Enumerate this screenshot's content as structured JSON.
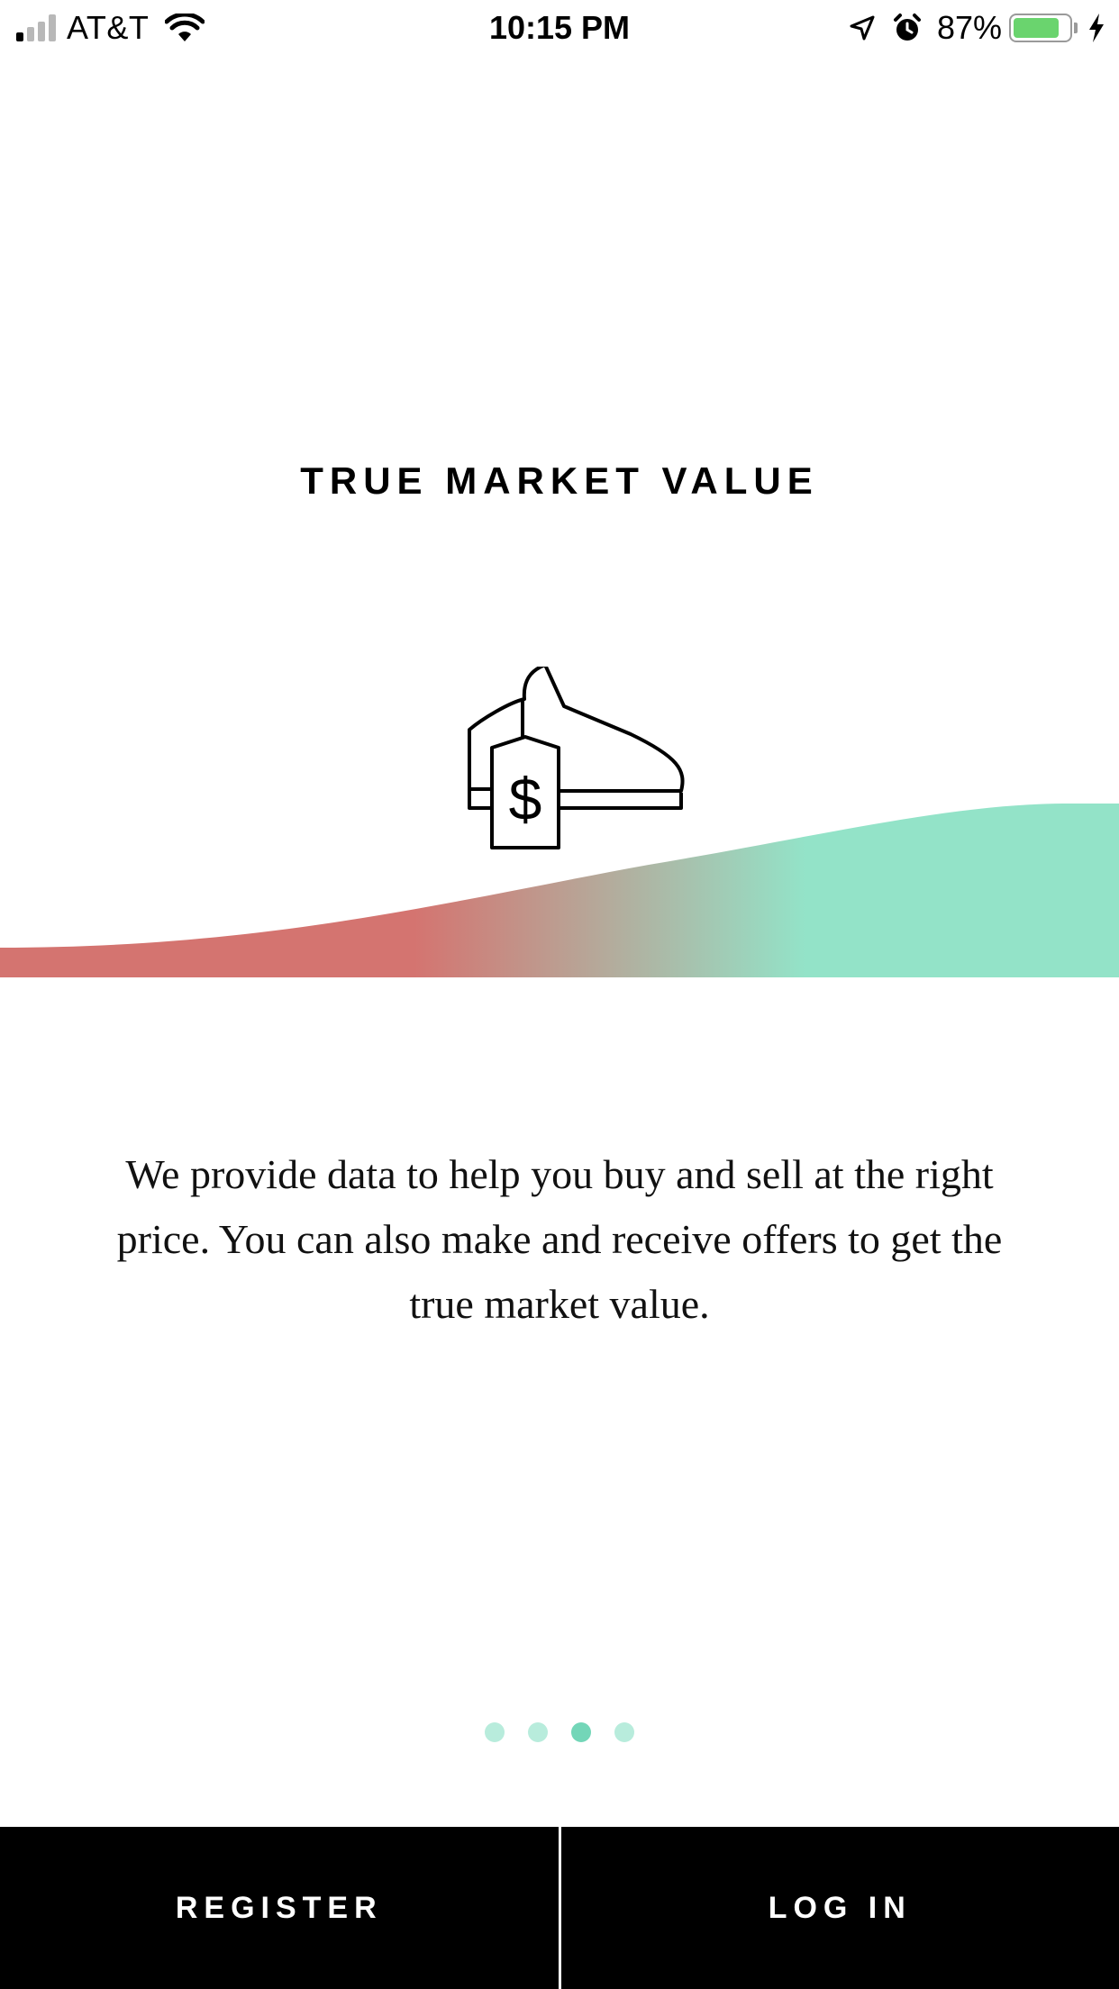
{
  "status_bar": {
    "carrier": "AT&T",
    "time": "10:15 PM",
    "battery_percent_text": "87%",
    "battery_level": 0.87,
    "signal_bars_active": 1,
    "signal_bars_total": 4,
    "icons": [
      "signal-icon",
      "wifi-icon",
      "location-arrow-icon",
      "alarm-icon",
      "battery-icon",
      "charging-bolt-icon"
    ],
    "battery_color": "#6ad46e"
  },
  "onboarding": {
    "title": "TRUE MARKET VALUE",
    "illustration": {
      "icons": [
        "sneaker-icon",
        "price-tag-icon"
      ],
      "price_symbol": "$",
      "gradient_colors": [
        "#d47470",
        "#93e3c8"
      ]
    },
    "description": "We provide data to help you buy and sell at the right price. You can also make and receive offers to get the true market value."
  },
  "pager": {
    "total": 4,
    "active_index": 2,
    "active_color": "#73d6b8",
    "inactive_color": "#b8ecdc"
  },
  "actions": {
    "register_label": "REGISTER",
    "login_label": "LOG IN"
  }
}
